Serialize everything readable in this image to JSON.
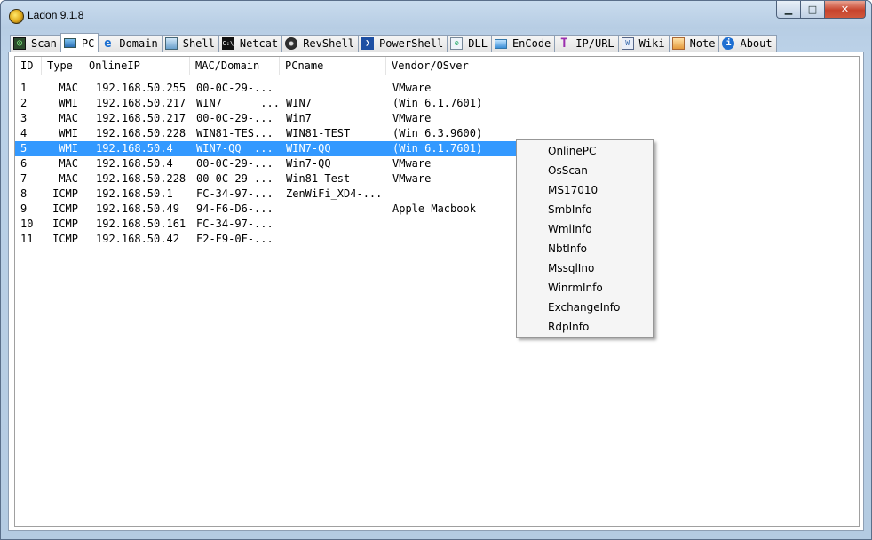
{
  "window": {
    "title": "Ladon 9.1.8"
  },
  "tabs": [
    {
      "label": "Scan",
      "icon": "scan-icon",
      "active": false
    },
    {
      "label": "PC",
      "icon": "computer-icon",
      "active": true
    },
    {
      "label": "Domain",
      "icon": "internet-explorer-icon",
      "active": false
    },
    {
      "label": "Shell",
      "icon": "network-icon",
      "active": false
    },
    {
      "label": "Netcat",
      "icon": "terminal-icon",
      "active": false
    },
    {
      "label": "RevShell",
      "icon": "webcam-icon",
      "active": false
    },
    {
      "label": "PowerShell",
      "icon": "powershell-icon",
      "active": false
    },
    {
      "label": "DLL",
      "icon": "dll-file-icon",
      "active": false
    },
    {
      "label": "EnCode",
      "icon": "encode-icon",
      "active": false
    },
    {
      "label": "IP/URL",
      "icon": "text-t-icon",
      "active": false
    },
    {
      "label": "Wiki",
      "icon": "wiki-book-icon",
      "active": false
    },
    {
      "label": "Note",
      "icon": "note-icon",
      "active": false
    },
    {
      "label": "About",
      "icon": "info-icon",
      "active": false
    }
  ],
  "columns": [
    "ID",
    "Type",
    "OnlineIP",
    "MAC/Domain",
    "PCname",
    "Vendor/OSver"
  ],
  "rows": [
    {
      "id": "1",
      "type": "MAC",
      "ip": "192.168.50.255",
      "mac": "00-0C-29-...",
      "pcname": "",
      "vendor": "VMware"
    },
    {
      "id": "2",
      "type": "WMI",
      "ip": "192.168.50.217",
      "mac": "WIN7      ...",
      "pcname": "WIN7",
      "vendor": "(Win 6.1.7601)"
    },
    {
      "id": "3",
      "type": "MAC",
      "ip": "192.168.50.217",
      "mac": "00-0C-29-...",
      "pcname": "Win7",
      "vendor": "VMware"
    },
    {
      "id": "4",
      "type": "WMI",
      "ip": "192.168.50.228",
      "mac": "WIN81-TES...",
      "pcname": "WIN81-TEST",
      "vendor": "(Win 6.3.9600)"
    },
    {
      "id": "5",
      "type": "WMI",
      "ip": "192.168.50.4",
      "mac": "WIN7-QQ  ...",
      "pcname": "WIN7-QQ",
      "vendor": "(Win 6.1.7601)"
    },
    {
      "id": "6",
      "type": "MAC",
      "ip": "192.168.50.4",
      "mac": "00-0C-29-...",
      "pcname": "Win7-QQ",
      "vendor": "VMware"
    },
    {
      "id": "7",
      "type": "MAC",
      "ip": "192.168.50.228",
      "mac": "00-0C-29-...",
      "pcname": "Win81-Test",
      "vendor": "VMware"
    },
    {
      "id": "8",
      "type": "ICMP",
      "ip": "192.168.50.1",
      "mac": "FC-34-97-...",
      "pcname": "ZenWiFi_XD4-...",
      "vendor": ""
    },
    {
      "id": "9",
      "type": "ICMP",
      "ip": "192.168.50.49",
      "mac": "94-F6-D6-...",
      "pcname": "",
      "vendor": "Apple Macbook"
    },
    {
      "id": "10",
      "type": "ICMP",
      "ip": "192.168.50.161",
      "mac": "FC-34-97-...",
      "pcname": "",
      "vendor": ""
    },
    {
      "id": "11",
      "type": "ICMP",
      "ip": "192.168.50.42",
      "mac": "F2-F9-0F-...",
      "pcname": "",
      "vendor": ""
    }
  ],
  "selected_row": "5",
  "context_menu": [
    "OnlinePC",
    "OsScan",
    "MS17010",
    "SmbInfo",
    "WmiInfo",
    "NbtInfo",
    "MssqlIno",
    "WinrmInfo",
    "ExchangeInfo",
    "RdpInfo"
  ],
  "colors": {
    "selection": "#3399ff",
    "close_button": "#c7432c"
  }
}
